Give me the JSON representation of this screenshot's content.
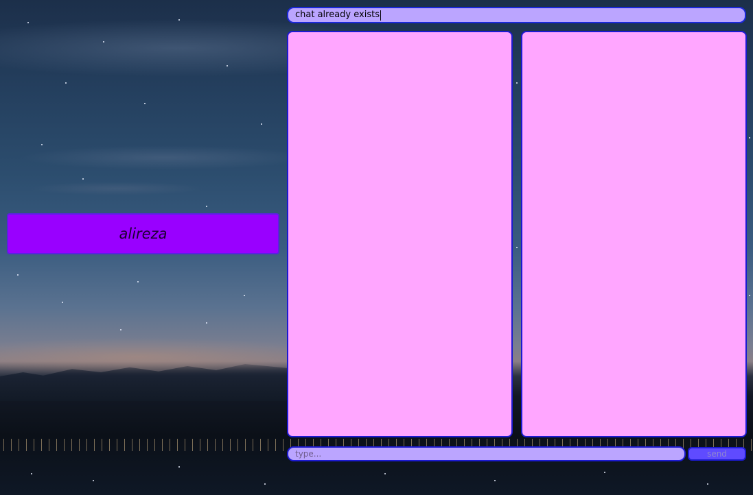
{
  "contact": {
    "name": "alireza"
  },
  "status": {
    "text": "chat already exists"
  },
  "composer": {
    "placeholder": "type...",
    "value": "",
    "send_label": "send"
  },
  "colors": {
    "contact_button": "#9900ff",
    "field_background": "#bba5ff",
    "panel_background": "#ffa6ff",
    "border": "#1c1ad0",
    "send_button": "#5f4bff"
  }
}
